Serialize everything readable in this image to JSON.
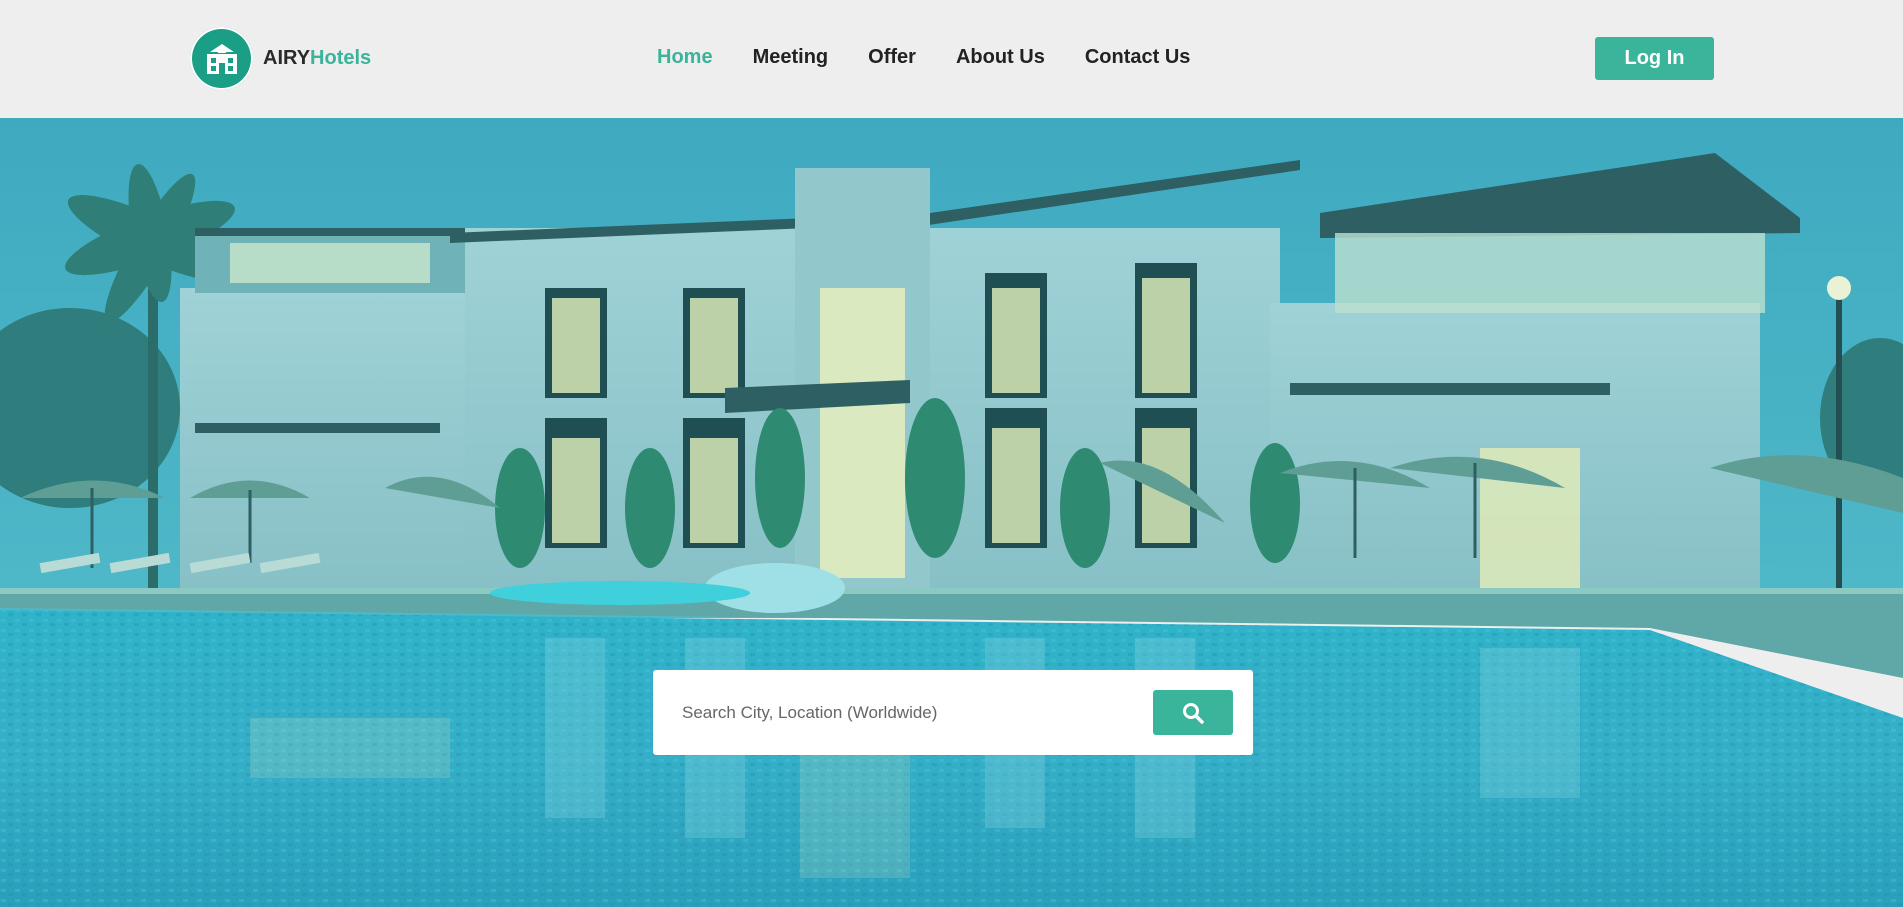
{
  "brand": {
    "name_part1": "AIRY",
    "name_part2": "Hotels",
    "logo_icon": "hotel-building-icon"
  },
  "nav": {
    "items": [
      {
        "label": "Home",
        "active": true
      },
      {
        "label": "Meeting",
        "active": false
      },
      {
        "label": "Offer",
        "active": false
      },
      {
        "label": "About Us",
        "active": false
      },
      {
        "label": "Contact Us",
        "active": false
      }
    ]
  },
  "header": {
    "login_label": "Log In"
  },
  "search": {
    "placeholder": "Search City, Location (Worldwide)",
    "value": "",
    "button_icon": "search-icon"
  },
  "colors": {
    "accent": "#3ab49a",
    "logo_bg": "#1a9e85",
    "header_bg": "#eeeeee",
    "nav_text": "#222222"
  }
}
